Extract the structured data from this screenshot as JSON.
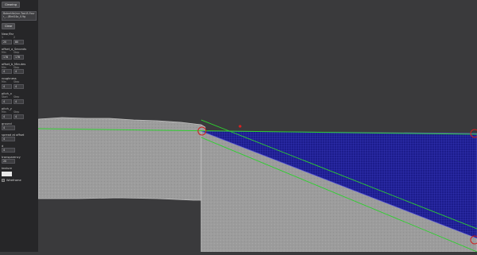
{
  "sidebar": {
    "top_button": "Clearing",
    "file_path": "Bobwhite/run-Tool-B-Fourr_.../Bird14a_0.9g",
    "load_button": "Clear",
    "groups": [
      {
        "label": "Near/Far",
        "fields": [
          {
            "label": "1",
            "value": "20"
          },
          {
            "label": "2",
            "value": "80"
          }
        ]
      },
      {
        "label": "offset_a_Seconds",
        "fields": [
          {
            "label": "Min",
            "value": "178"
          },
          {
            "label": "Step",
            "value": "178"
          }
        ]
      },
      {
        "label": "offset_b_Minutes",
        "fields": [
          {
            "label": "Min",
            "value": "4"
          },
          {
            "label": "Step",
            "value": "4"
          }
        ]
      },
      {
        "label": "roughness",
        "fields": [
          {
            "label": "Min",
            "value": "4"
          },
          {
            "label": "Step",
            "value": "4"
          }
        ]
      },
      {
        "label": "pitch_x",
        "fields": [
          {
            "label": "Start",
            "value": "4"
          },
          {
            "label": "Step",
            "value": "4"
          }
        ]
      },
      {
        "label": "pitch_y",
        "fields": [
          {
            "label": "Min",
            "value": "4"
          },
          {
            "label": "Step",
            "value": "4"
          }
        ]
      },
      {
        "label": "ground",
        "fields": [
          {
            "label": "",
            "value": "4"
          }
        ]
      },
      {
        "label": "spread at offset",
        "fields": [
          {
            "label": "",
            "value": "4"
          }
        ]
      },
      {
        "label": "d",
        "fields": [
          {
            "label": "",
            "value": "4"
          }
        ]
      },
      {
        "label": "transparency",
        "fields": [
          {
            "label": "",
            "value": "20"
          }
        ]
      },
      {
        "label": "texture",
        "fields": []
      }
    ],
    "checkbox_label": "Wireframe"
  },
  "viewport": {
    "colors": {
      "background": "#3a3a3c",
      "terrain": "#9c9c9c",
      "terrain_edge": "#c4c4c4",
      "mesh_fill": "#1c1c8c",
      "mesh_line": "#3f3fc8",
      "guide_line": "#2ed02e",
      "handle": "#d02020"
    }
  }
}
